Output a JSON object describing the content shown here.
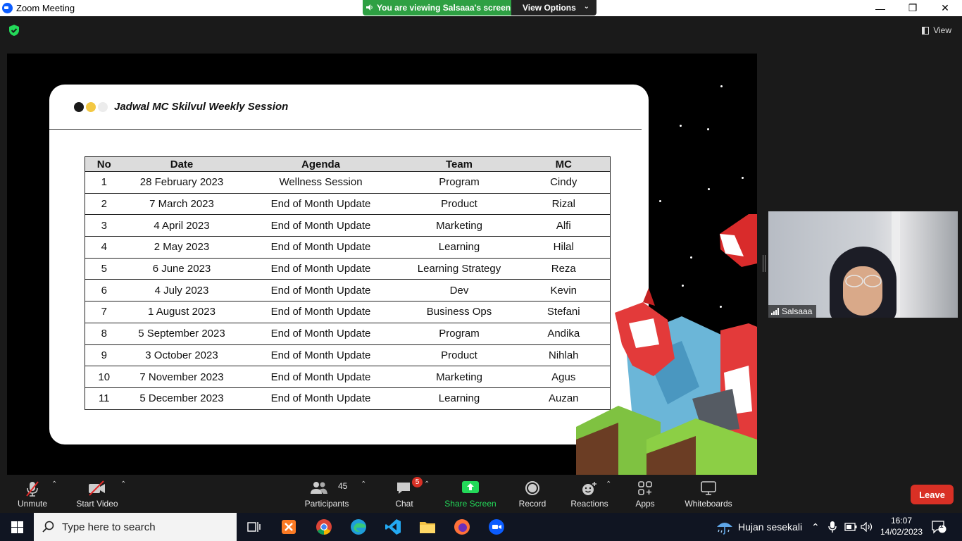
{
  "window": {
    "title": "Zoom Meeting"
  },
  "banner": {
    "viewing": "You are viewing Salsaaa's screen",
    "view_options": "View Options"
  },
  "top": {
    "view_label": "View"
  },
  "slide": {
    "title": "Jadwal MC Skilvul Weekly Session",
    "dot_colors": [
      "#1a1a1a",
      "#f3c843",
      "#ececec"
    ],
    "headers": [
      "No",
      "Date",
      "Agenda",
      "Team",
      "MC"
    ],
    "rows": [
      [
        "1",
        "28 February 2023",
        "Wellness Session",
        "Program",
        "Cindy"
      ],
      [
        "2",
        "7 March 2023",
        "End of Month Update",
        "Product",
        "Rizal"
      ],
      [
        "3",
        "4 April 2023",
        "End of Month Update",
        "Marketing",
        "Alfi"
      ],
      [
        "4",
        "2 May 2023",
        "End of Month Update",
        "Learning",
        "Hilal"
      ],
      [
        "5",
        "6 June 2023",
        "End of Month Update",
        "Learning Strategy",
        "Reza"
      ],
      [
        "6",
        "4 July 2023",
        "End of Month Update",
        "Dev",
        "Kevin"
      ],
      [
        "7",
        "1 August 2023",
        "End of Month Update",
        "Business Ops",
        "Stefani"
      ],
      [
        "8",
        "5 September 2023",
        "End of Month Update",
        "Program",
        "Andika"
      ],
      [
        "9",
        "3 October 2023",
        "End of Month Update",
        "Product",
        "Nihlah"
      ],
      [
        "10",
        "7 November 2023",
        "End of Month Update",
        "Marketing",
        "Agus"
      ],
      [
        "11",
        "5 December 2023",
        "End of Month Update",
        "Learning",
        "Auzan"
      ]
    ]
  },
  "video": {
    "participant_name": "Salsaaa"
  },
  "toolbar": {
    "unmute": "Unmute",
    "start_video": "Start Video",
    "participants": "Participants",
    "participants_count": "45",
    "chat": "Chat",
    "chat_badge": "5",
    "share_screen": "Share Screen",
    "record": "Record",
    "reactions": "Reactions",
    "apps": "Apps",
    "whiteboards": "Whiteboards",
    "leave": "Leave",
    "share_color": "#23d959",
    "leave_color": "#d93025"
  },
  "taskbar": {
    "search_placeholder": "Type here to search",
    "weather": "Hujan sesekali",
    "time": "16:07",
    "date": "14/02/2023",
    "notification_count": "1"
  }
}
